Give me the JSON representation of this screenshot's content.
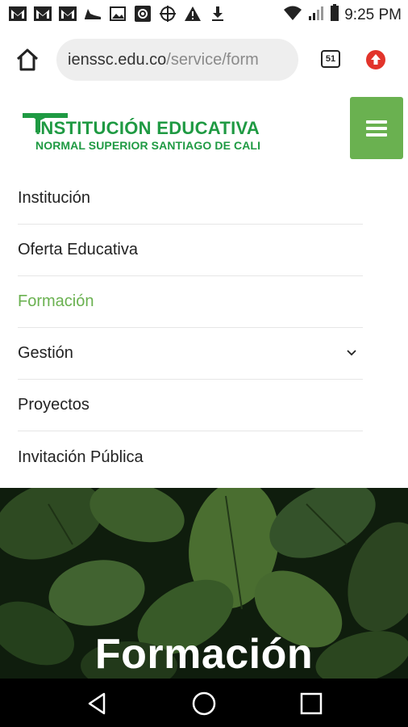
{
  "status_bar": {
    "time": "9:25 PM",
    "left_icons": [
      "gmail-icon",
      "gmail-icon",
      "gmail-icon",
      "shoe-icon",
      "image-icon",
      "at-sign-icon",
      "crosshair-icon",
      "warning-icon",
      "download-icon"
    ],
    "right_icons": [
      "wifi-icon",
      "signal-icon",
      "battery-icon"
    ]
  },
  "browser": {
    "url_host": "ienssc.edu.co",
    "url_path": "/service/form",
    "tab_count": "51"
  },
  "header": {
    "logo_line1": "INSTITUCIÓN EDUCATIVA",
    "logo_line2": "NORMAL SUPERIOR SANTIAGO DE CALI"
  },
  "nav": {
    "items": [
      {
        "label": "Institución"
      },
      {
        "label": "Oferta Educativa"
      },
      {
        "label": "Formación"
      },
      {
        "label": "Gestión"
      },
      {
        "label": "Proyectos"
      },
      {
        "label": "Invitación Pública"
      }
    ]
  },
  "hero": {
    "title": "Formación"
  },
  "colors": {
    "brand_green": "#1f9a43",
    "accent_green": "#6ab150",
    "text_dark": "#222222"
  }
}
